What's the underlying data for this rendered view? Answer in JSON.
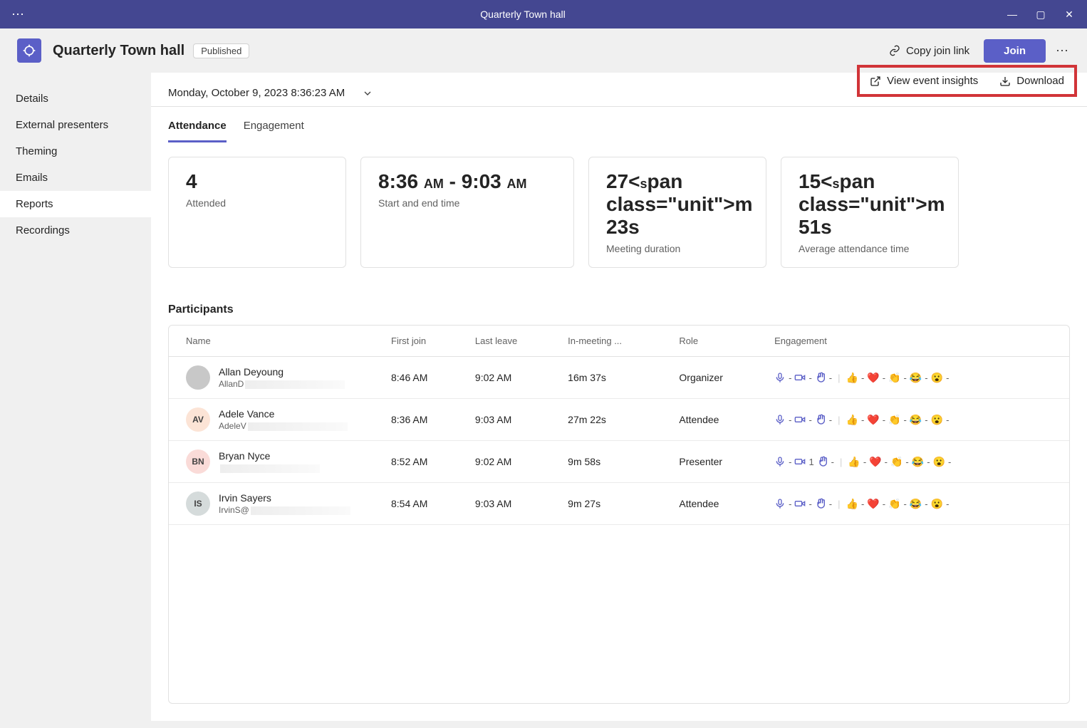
{
  "titlebar": {
    "title": "Quarterly Town hall"
  },
  "header": {
    "title": "Quarterly Town hall",
    "status": "Published",
    "copy_link": "Copy join link",
    "join": "Join"
  },
  "sidebar": {
    "items": [
      {
        "label": "Details"
      },
      {
        "label": "External presenters"
      },
      {
        "label": "Theming"
      },
      {
        "label": "Emails"
      },
      {
        "label": "Reports"
      },
      {
        "label": "Recordings"
      }
    ]
  },
  "toolbar": {
    "date": "Monday, October 9, 2023 8:36:23 AM",
    "view_insights": "View event insights",
    "download": "Download"
  },
  "tabs": [
    {
      "label": "Attendance"
    },
    {
      "label": "Engagement"
    }
  ],
  "stats": {
    "attended": {
      "value": "4",
      "label": "Attended"
    },
    "time_range": {
      "value": "8:36 AM - 9:03 AM",
      "label": "Start and end time"
    },
    "duration": {
      "value": "27m 23s",
      "label": "Meeting duration"
    },
    "avg": {
      "value": "15m 51s",
      "label": "Average attendance time"
    }
  },
  "participants_title": "Participants",
  "columns": {
    "name": "Name",
    "first_join": "First join",
    "last_leave": "Last leave",
    "in_meeting": "In-meeting ...",
    "role": "Role",
    "engagement": "Engagement"
  },
  "participants": [
    {
      "initials": "",
      "avatar": "photo",
      "name": "Allan Deyoung",
      "email": "AllanD",
      "first_join": "8:46 AM",
      "last_leave": "9:02 AM",
      "in_meeting": "16m 37s",
      "role": "Organizer",
      "mic": "-",
      "cam": "-",
      "hand": "-"
    },
    {
      "initials": "AV",
      "avatar": "av1",
      "name": "Adele Vance",
      "email": "AdeleV",
      "first_join": "8:36 AM",
      "last_leave": "9:03 AM",
      "in_meeting": "27m 22s",
      "role": "Attendee",
      "mic": "-",
      "cam": "-",
      "hand": "-"
    },
    {
      "initials": "BN",
      "avatar": "av2",
      "name": "Bryan Nyce",
      "email": "",
      "first_join": "8:52 AM",
      "last_leave": "9:02 AM",
      "in_meeting": "9m 58s",
      "role": "Presenter",
      "mic": "-",
      "cam": "1",
      "hand": "-"
    },
    {
      "initials": "IS",
      "avatar": "av3",
      "name": "Irvin Sayers",
      "email": "IrvinS@",
      "first_join": "8:54 AM",
      "last_leave": "9:03 AM",
      "in_meeting": "9m 27s",
      "role": "Attendee",
      "mic": "-",
      "cam": "-",
      "hand": "-"
    }
  ],
  "reactions": [
    "👍",
    "❤️",
    "👏",
    "😂",
    "😮"
  ]
}
